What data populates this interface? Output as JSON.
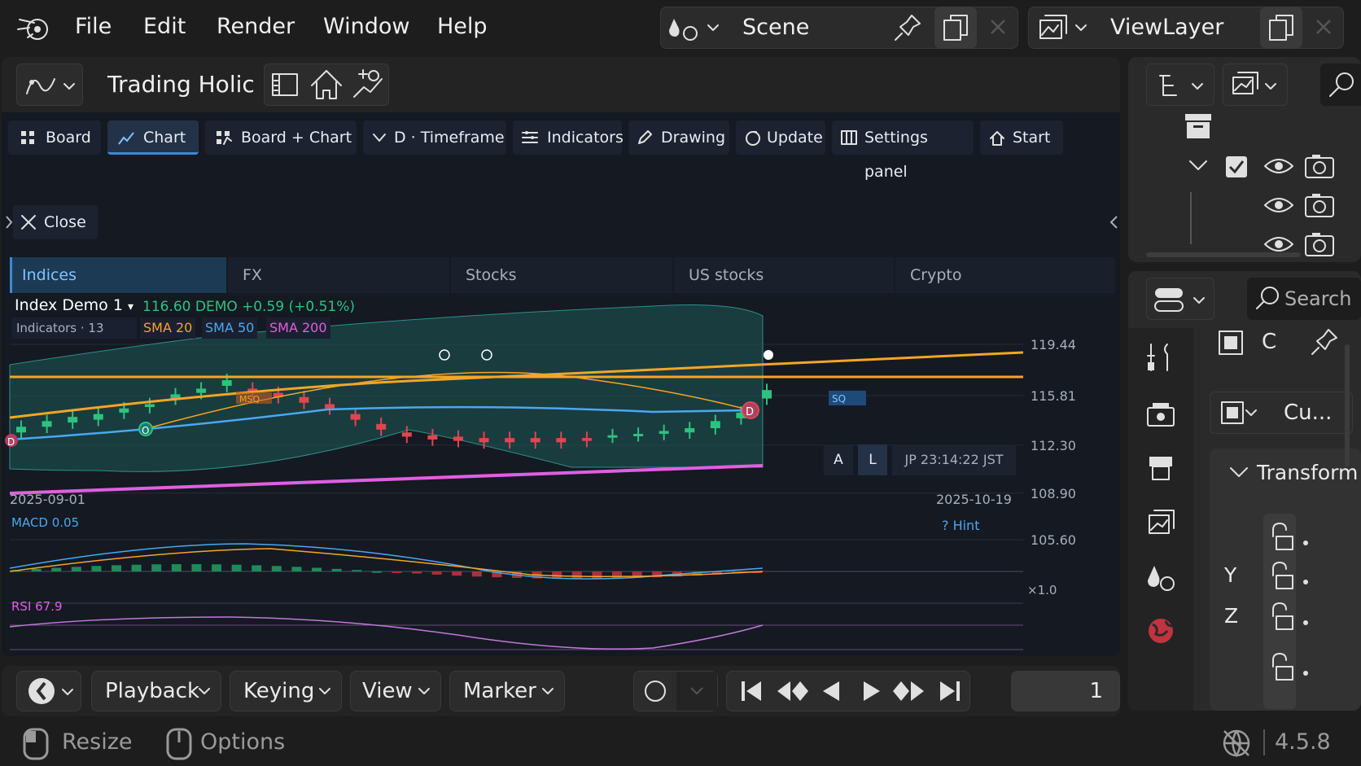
{
  "menu": {
    "file": "File",
    "edit": "Edit",
    "render": "Render",
    "window": "Window",
    "help": "Help"
  },
  "scene": {
    "label": "Scene"
  },
  "view_layer": {
    "label": "ViewLayer"
  },
  "editor": {
    "title": "Trading Holic",
    "toolbar": {
      "board": "Board",
      "chart": "Chart",
      "board_chart": "Board + Chart",
      "timeframe": "D · Timeframe",
      "indicators": "Indicators",
      "drawing": "Drawing",
      "update": "Update",
      "settings_panel": "Settings panel",
      "start": "Start"
    },
    "close": "Close",
    "tabs": [
      "Indices",
      "FX",
      "Stocks",
      "US stocks",
      "Crypto"
    ],
    "active_tab": "Indices"
  },
  "chart": {
    "symbol": "Index Demo 1",
    "symbol_caret": "▾",
    "price": "116.60 DEMO",
    "change": "+0.59 (+0.51%)",
    "indicators_label": "Indicators · 13",
    "sma20": "SMA 20",
    "sma50": "SMA 50",
    "sma200": "SMA 200",
    "msq": "MSQ",
    "sq": "SQ",
    "price_axis": [
      "119.44",
      "115.81",
      "112.30",
      "108.90",
      "105.60"
    ],
    "date_start": "2025-09-01",
    "date_end": "2025-10-19",
    "scale_a": "A",
    "scale_l": "L",
    "clock": "JP 23:14:22 JST",
    "marker_d": "D",
    "marker_o": "O",
    "macd_label": "MACD 0.05",
    "rsi_label": "RSI 67.9",
    "hint": "? Hint",
    "pane_scale": "×1.0",
    "colors": {
      "up": "#2ec27e",
      "down": "#e0464f",
      "sma20": "#f5a623",
      "sma50": "#4aa8f0",
      "sma200": "#e05fe0",
      "band": "#1d5a57"
    }
  },
  "chart_data": {
    "type": "candlestick",
    "x_range": [
      "2025-09-01",
      "2025-10-19"
    ],
    "ylim": [
      105.6,
      119.44
    ],
    "y_ticks": [
      119.44,
      115.81,
      112.3,
      108.9,
      105.6
    ],
    "series": [
      {
        "name": "SMA 20"
      },
      {
        "name": "SMA 50"
      },
      {
        "name": "SMA 200"
      }
    ],
    "candles": [
      {
        "o": 113.2,
        "c": 113.6
      },
      {
        "o": 113.6,
        "c": 114.0
      },
      {
        "o": 113.9,
        "c": 114.3
      },
      {
        "o": 114.1,
        "c": 114.5
      },
      {
        "o": 114.6,
        "c": 114.9
      },
      {
        "o": 115.0,
        "c": 115.2
      },
      {
        "o": 115.6,
        "c": 115.9
      },
      {
        "o": 116.0,
        "c": 116.3
      },
      {
        "o": 116.5,
        "c": 116.9
      },
      {
        "o": 116.3,
        "c": 116.1
      },
      {
        "o": 116.0,
        "c": 115.7
      },
      {
        "o": 115.7,
        "c": 115.3
      },
      {
        "o": 115.2,
        "c": 114.9
      },
      {
        "o": 114.5,
        "c": 114.1
      },
      {
        "o": 113.8,
        "c": 113.4
      },
      {
        "o": 113.2,
        "c": 112.9
      },
      {
        "o": 113.0,
        "c": 112.7
      },
      {
        "o": 112.9,
        "c": 112.6
      },
      {
        "o": 112.8,
        "c": 112.5
      },
      {
        "o": 112.8,
        "c": 112.5
      },
      {
        "o": 112.8,
        "c": 112.5
      },
      {
        "o": 112.8,
        "c": 112.5
      },
      {
        "o": 112.8,
        "c": 112.6
      },
      {
        "o": 112.9,
        "c": 113.0
      },
      {
        "o": 113.0,
        "c": 113.1
      },
      {
        "o": 113.1,
        "c": 113.3
      },
      {
        "o": 113.2,
        "c": 113.5
      },
      {
        "o": 113.5,
        "c": 114.0
      },
      {
        "o": 114.2,
        "c": 114.6
      },
      {
        "o": 115.6,
        "c": 116.2
      }
    ],
    "macd": {
      "value": 0.05
    },
    "rsi": {
      "value": 67.9
    }
  },
  "right_panel": {
    "search_placeholder": "Search",
    "c_label": "C",
    "cu_label": "Cu...",
    "transform": "Transform",
    "axes": [
      "Y",
      "Z"
    ]
  },
  "timeline": {
    "playback": "Playback",
    "keying": "Keying",
    "view": "View",
    "marker": "Marker",
    "frame": "1"
  },
  "status": {
    "resize": "Resize",
    "options": "Options",
    "version": "4.5.8"
  }
}
